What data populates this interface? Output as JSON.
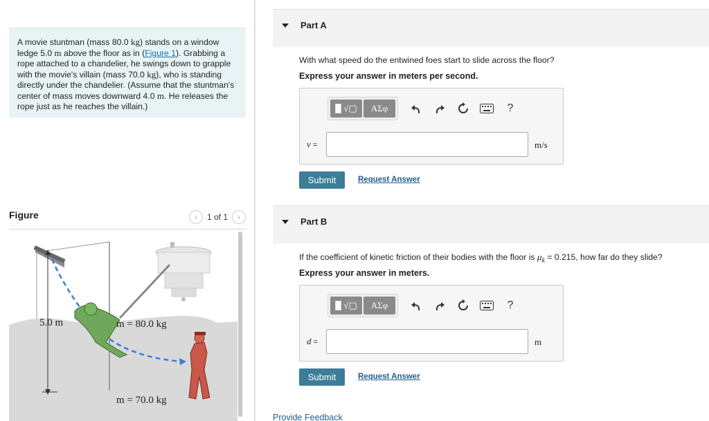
{
  "problem": {
    "text_1": "A movie stuntman (mass 80.0 ",
    "unit_kg": "kg",
    "text_2": ") stands on a window ledge 5.0 ",
    "unit_m": "m",
    "text_3": " above the floor as in (",
    "figure_link": "Figure 1",
    "text_4": "). Grabbing a rope attached to a chandelier, he swings down to grapple with the movie's villain (mass 70.0 ",
    "unit_kg2": "kg",
    "text_5": "), who is standing directly under the chandelier. (Assume that the stuntman's center of mass moves downward 4.0 ",
    "unit_m2": "m",
    "text_6": ". He releases the rope just as he reaches the villain.)"
  },
  "figure": {
    "title": "Figure",
    "pager": "1 of 1",
    "prev_icon": "chevron-left-icon",
    "next_icon": "chevron-right-icon",
    "height_label": "5.0 m",
    "stuntman_label": "m = 80.0 kg",
    "villain_label": "m = 70.0 kg"
  },
  "part_a": {
    "title": "Part A",
    "question": "With what speed do the entwined foes start to slide across the floor?",
    "instruction": "Express your answer in meters per second.",
    "variable": "v",
    "equals": " =",
    "value": "",
    "unit": "m/s",
    "submit": "Submit",
    "request": "Request Answer"
  },
  "part_b": {
    "title": "Part B",
    "question_1": "If the coefficient of kinetic friction of their bodies with the floor is ",
    "mu_symbol": "μ",
    "mu_sub": "k",
    "question_2": " = 0.215, how far do they slide?",
    "instruction": "Express your answer in meters.",
    "variable": "d",
    "equals": " =",
    "value": "",
    "unit": "m",
    "submit": "Submit",
    "request": "Request Answer"
  },
  "toolbar": {
    "greek": "ΑΣφ",
    "help": "?",
    "icons": [
      "templates-icon",
      "greek-letters-icon",
      "undo-icon",
      "redo-icon",
      "reset-icon",
      "keyboard-icon",
      "help-icon"
    ]
  },
  "footer": {
    "feedback": "Provide Feedback"
  },
  "colors": {
    "problem_bg": "#e8f3f6",
    "submit_bg": "#3c7d98",
    "link": "#1f5f8b",
    "part_bar": "#f3f3f3"
  }
}
